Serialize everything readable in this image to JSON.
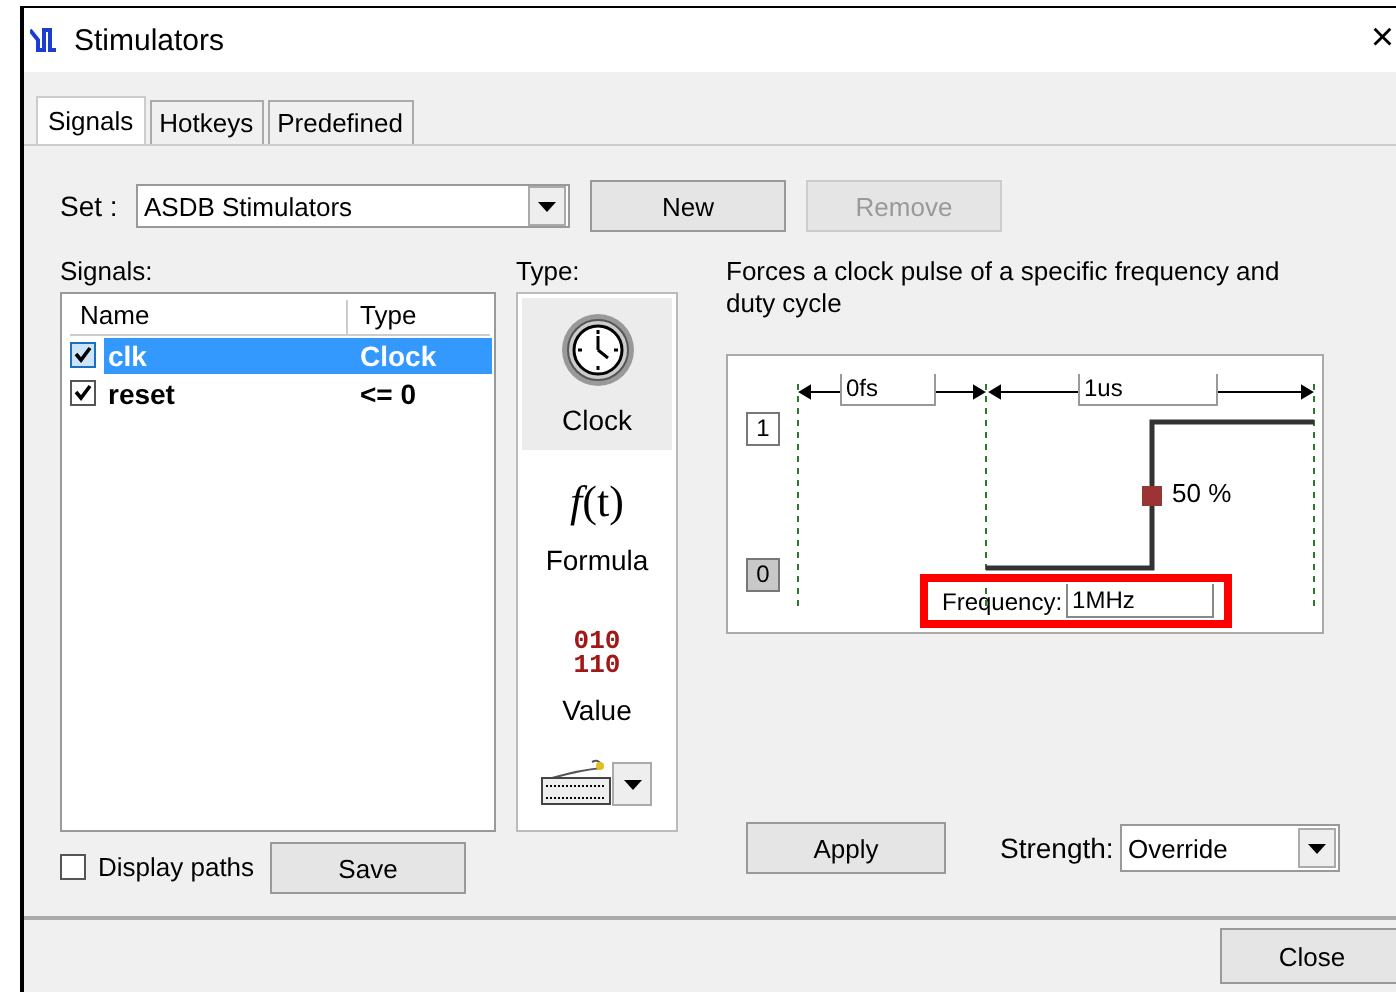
{
  "window": {
    "title": "Stimulators",
    "close": "×"
  },
  "tabs": [
    {
      "label": "Signals",
      "selected": true
    },
    {
      "label": "Hotkeys",
      "selected": false
    },
    {
      "label": "Predefined",
      "selected": false
    }
  ],
  "set": {
    "label": "Set :",
    "value": "ASDB Stimulators"
  },
  "set_buttons": [
    {
      "label": "New",
      "disabled": false
    },
    {
      "label": "Remove",
      "disabled": true
    }
  ],
  "signals": {
    "label": "Signals:",
    "columns": [
      "Name",
      "Type"
    ],
    "rows": [
      {
        "name": "clk",
        "type": "Clock",
        "checked": true,
        "selected": true
      },
      {
        "name": "reset",
        "type": "<= 0",
        "checked": true,
        "selected": false
      }
    ]
  },
  "type_panel": {
    "label": "Type:",
    "items": [
      {
        "kind": "clock",
        "label": "Clock",
        "selected": true
      },
      {
        "kind": "formula",
        "label": "Formula",
        "icon_text": "*f*(t)",
        "selected": false
      },
      {
        "kind": "value",
        "label": "Value",
        "icon_lines": [
          "010",
          "110"
        ],
        "selected": false
      }
    ]
  },
  "description": "Forces a clock pulse of a specific frequency and duty cycle",
  "diagram": {
    "offset": "0fs",
    "period": "1us",
    "high": "1",
    "low": "0",
    "low_selected": true,
    "duty": "50 %",
    "frequency_label": "Frequency:",
    "frequency": "1MHz",
    "highlighted": true
  },
  "display_paths": {
    "label": "Display paths",
    "checked": false
  },
  "save": "Save",
  "apply": "Apply",
  "strength": {
    "label": "Strength:",
    "value": "Override"
  },
  "close": "Close"
}
